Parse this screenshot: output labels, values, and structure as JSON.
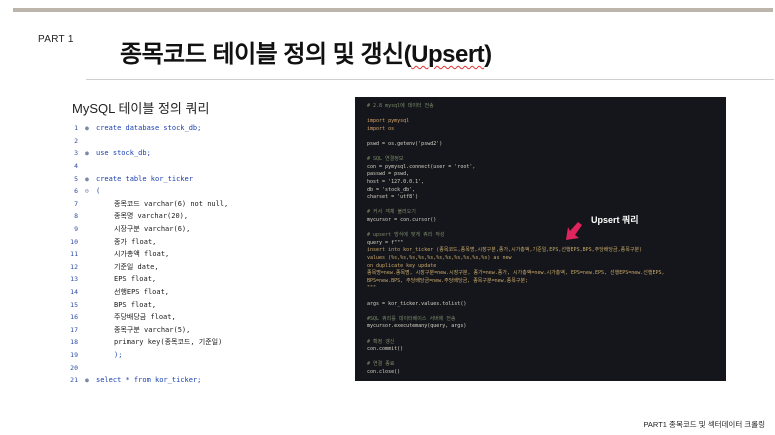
{
  "header": {
    "part": "PART 1",
    "title_main": "종목코드 테이블 정의 및 갱신(",
    "title_em": "Upsert",
    "title_tail": ")"
  },
  "mysql": {
    "heading": "MySQL 테이블 정의 쿼리",
    "lines": [
      {
        "n": "1",
        "fold": "●",
        "code": "create database stock_db;"
      },
      {
        "n": "2",
        "fold": "",
        "code": ""
      },
      {
        "n": "3",
        "fold": "●",
        "code": "use stock_db;"
      },
      {
        "n": "4",
        "fold": "",
        "code": ""
      },
      {
        "n": "5",
        "fold": "●",
        "code": "create table kor_ticker"
      },
      {
        "n": "6",
        "fold": "⊖",
        "code": "("
      },
      {
        "n": "7",
        "fold": "",
        "code": "종목코드 varchar(6) not null,"
      },
      {
        "n": "8",
        "fold": "",
        "code": "종목명 varchar(20),"
      },
      {
        "n": "9",
        "fold": "",
        "code": "시장구분 varchar(6),"
      },
      {
        "n": "10",
        "fold": "",
        "code": "종가 float,"
      },
      {
        "n": "11",
        "fold": "",
        "code": "시가총액 float,"
      },
      {
        "n": "12",
        "fold": "",
        "code": "기준일 date,"
      },
      {
        "n": "13",
        "fold": "",
        "code": "EPS float,"
      },
      {
        "n": "14",
        "fold": "",
        "code": "선행EPS float,"
      },
      {
        "n": "15",
        "fold": "",
        "code": "BPS float,"
      },
      {
        "n": "16",
        "fold": "",
        "code": "주당배당금 float,"
      },
      {
        "n": "17",
        "fold": "",
        "code": "종목구분 varchar(5),"
      },
      {
        "n": "18",
        "fold": "",
        "code": "primary key(종목코드, 기준일)"
      },
      {
        "n": "19",
        "fold": "",
        "code": ");"
      },
      {
        "n": "20",
        "fold": "",
        "code": ""
      },
      {
        "n": "21",
        "fold": "●",
        "code": "select * from kor_ticker;"
      }
    ]
  },
  "python": {
    "lines": [
      {
        "t": "c",
        "code": "# 2.8 mysql에 데이터 전송"
      },
      {
        "t": "",
        "code": ""
      },
      {
        "t": "k",
        "code": "import pymysql"
      },
      {
        "t": "k",
        "code": "import os"
      },
      {
        "t": "",
        "code": ""
      },
      {
        "t": "",
        "code": "pswd = os.getenv('pswd2')"
      },
      {
        "t": "",
        "code": ""
      },
      {
        "t": "c",
        "code": "# SQL 연결정보"
      },
      {
        "t": "",
        "code": "con = pymysql.connect(user = 'root',"
      },
      {
        "t": "",
        "code": "                      passwd = pswd,"
      },
      {
        "t": "",
        "code": "                      host = '127.0.0.1',"
      },
      {
        "t": "",
        "code": "                      db = 'stock_db',"
      },
      {
        "t": "",
        "code": "                      charset = 'utf8')"
      },
      {
        "t": "",
        "code": ""
      },
      {
        "t": "c",
        "code": "# 커서 객체 불러오기"
      },
      {
        "t": "",
        "code": "mycursor = con.cursor()"
      },
      {
        "t": "",
        "code": ""
      },
      {
        "t": "c",
        "code": "# upsert 방식에 맞게 쿼리 작성"
      },
      {
        "t": "",
        "code": "query = f\"\"\""
      },
      {
        "t": "s",
        "code": "    insert into kor_ticker (종목코드,종목명,시장구분,종가,시가총액,기준일,EPS,선행EPS,BPS,주당배당금,종목구분)"
      },
      {
        "t": "s",
        "code": "    values (%s,%s,%s,%s,%s,%s,%s,%s,%s,%s,%s) as new"
      },
      {
        "t": "s",
        "code": "    on duplicate key update"
      },
      {
        "t": "s",
        "code": "    종목명=new.종목명, 시장구분=new.시장구분, 종가=new.종가, 시가총액=new.시가총액, EPS=new.EPS, 선행EPS=new.선행EPS,"
      },
      {
        "t": "s",
        "code": "    BPS=new.BPS, 주당배당금=new.주당배당금, 종목구분=new.종목구분;"
      },
      {
        "t": "s",
        "code": "\"\"\""
      },
      {
        "t": "",
        "code": ""
      },
      {
        "t": "",
        "code": "args = kor_ticker.values.tolist()"
      },
      {
        "t": "",
        "code": ""
      },
      {
        "t": "c",
        "code": "#SQL 쿼리를 데이터베이스 서버에 전송"
      },
      {
        "t": "",
        "code": "mycursor.executemany(query, args)"
      },
      {
        "t": "",
        "code": ""
      },
      {
        "t": "c",
        "code": "# 확정 갱신"
      },
      {
        "t": "",
        "code": "con.commit()"
      },
      {
        "t": "",
        "code": ""
      },
      {
        "t": "c",
        "code": "# 연결 종료"
      },
      {
        "t": "",
        "code": "con.close()"
      }
    ]
  },
  "annotation": {
    "label": "Upsert 쿼리",
    "arrow_icon": "arrow-down-left-icon",
    "arrow_color": "#e0245e"
  },
  "footer": {
    "text": "PART1 종목코드 및 섹터데이터 크롤링"
  },
  "colors": {
    "top_rule": "#bdb5ab",
    "code_panel_bg": "#14161b",
    "sql_keyword": "#1a3fb0"
  }
}
